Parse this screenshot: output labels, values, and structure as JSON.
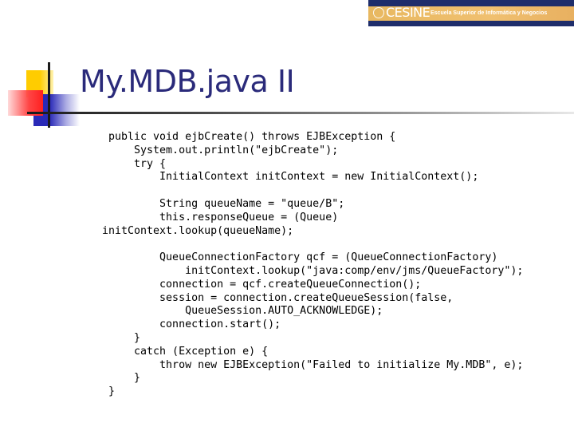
{
  "header": {
    "logo": {
      "name": "CESINE",
      "tagline": "Escuela Superior de Informática y Negocios",
      "colors": {
        "background": "#1e2d6b",
        "stripe": "#f0c070",
        "text": "#ffffff"
      }
    }
  },
  "slide": {
    "title": "My.MDB.java II",
    "title_color": "#2a2a7a",
    "code_lines": [
      " public void ejbCreate() throws EJBException {",
      "     System.out.println(\"ejbCreate\");",
      "     try {",
      "         InitialContext initContext = new InitialContext();",
      "",
      "         String queueName = \"queue/B\";",
      "         this.responseQueue = (Queue)",
      "initContext.lookup(queueName);",
      "",
      "         QueueConnectionFactory qcf = (QueueConnectionFactory)",
      "             initContext.lookup(\"java:comp/env/jms/QueueFactory\");",
      "         connection = qcf.createQueueConnection();",
      "         session = connection.createQueueSession(false,",
      "             QueueSession.AUTO_ACKNOWLEDGE);",
      "         connection.start();",
      "     }",
      "     catch (Exception e) {",
      "         throw new EJBException(\"Failed to initialize My.MDB\", e);",
      "     }",
      " }"
    ]
  }
}
